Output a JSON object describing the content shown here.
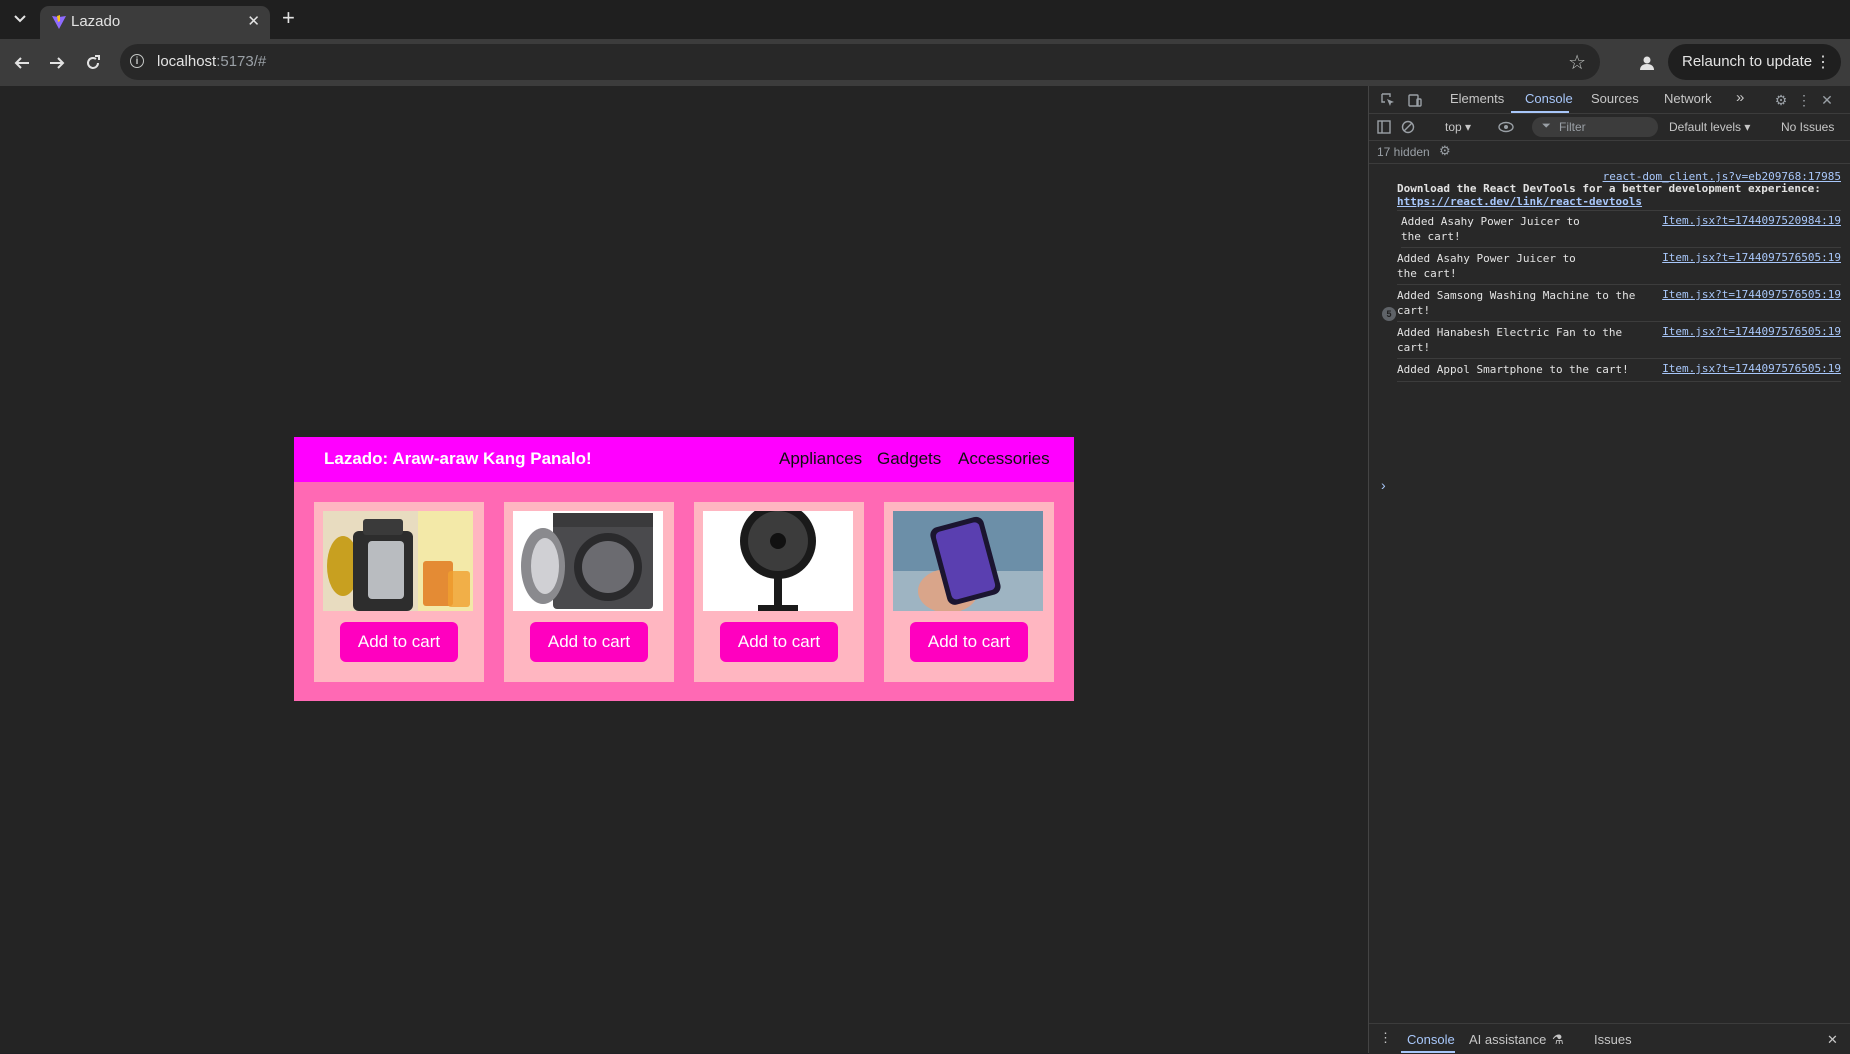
{
  "browser": {
    "tab_title": "Lazado",
    "url_host": "localhost",
    "url_rest": ":5173/#",
    "relaunch_label": "Relaunch to update"
  },
  "app": {
    "title": "Lazado: Araw-araw Kang Panalo!",
    "nav": [
      "Appliances",
      "Gadgets",
      "Accessories"
    ],
    "products": [
      {
        "image": "juicer-image",
        "button": "Add to cart"
      },
      {
        "image": "washing-machine-image",
        "button": "Add to cart"
      },
      {
        "image": "electric-fan-image",
        "button": "Add to cart"
      },
      {
        "image": "smartphone-image",
        "button": "Add to cart"
      }
    ]
  },
  "devtools": {
    "tabs": [
      "Elements",
      "Console",
      "Sources",
      "Network"
    ],
    "context": "top",
    "filter_placeholder": "Filter",
    "levels": "Default levels",
    "issues": "No Issues",
    "hidden": "17 hidden",
    "react_source": "react-dom_client.js?v=eb209768:17985",
    "react_msg": "Download the React DevTools for a better development experience:",
    "react_link": "https://react.dev/link/react-devtools",
    "logs": [
      {
        "count": "5",
        "text": "Added Asahy Power Juicer to the cart!",
        "source": "Item.jsx?t=1744097520984:19"
      },
      {
        "text": "Added Asahy Power Juicer to the cart!",
        "source": "Item.jsx?t=1744097576505:19"
      },
      {
        "text": "Added Samsong Washing Machine to the cart!",
        "source": "Item.jsx?t=1744097576505:19"
      },
      {
        "text": "Added Hanabesh Electric Fan to the cart!",
        "source": "Item.jsx?t=1744097576505:19"
      },
      {
        "text": "Added Appol Smartphone to the cart!",
        "source": "Item.jsx?t=1744097576505:19"
      }
    ],
    "drawer_tabs": [
      "Console",
      "AI assistance",
      "Issues"
    ]
  },
  "colors": {
    "header": "#ff00ff",
    "app_bg": "#ff69b4",
    "card_bg": "#ffb6c1",
    "button": "#ff00bf"
  }
}
